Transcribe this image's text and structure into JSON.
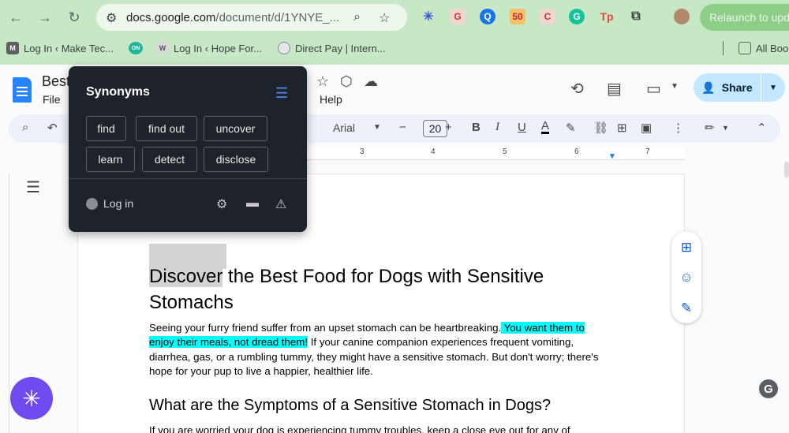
{
  "browser": {
    "url_host": "docs.google.com",
    "url_path": "/document/d/1YNYE_...",
    "relaunch_label": "Relaunch to upd",
    "bookmarks": [
      {
        "label": "Log In ‹ Make Tec...",
        "icon": "M"
      },
      {
        "label": "ON",
        "icon": ""
      },
      {
        "label": "Log In ‹ Hope For...",
        "icon": "W"
      },
      {
        "label": "Direct Pay | Intern...",
        "icon": ""
      }
    ],
    "all_bookmarks": "All Boo"
  },
  "docs": {
    "title": "Best",
    "menus": [
      "File",
      "Help"
    ],
    "share_label": "Share",
    "font": "Arial",
    "font_size": "20",
    "ruler_numbers": [
      "3",
      "4",
      "5",
      "6",
      "7"
    ]
  },
  "synonyms": {
    "title": "Synonyms",
    "chips": [
      "find",
      "find out",
      "uncover",
      "learn",
      "detect",
      "disclose"
    ],
    "login_label": "Log in"
  },
  "document": {
    "heading_highlight": "Discover",
    "heading_rest": " the Best Food for Dogs with Sensitive Stomachs",
    "para_start": "Seeing your furry friend suffer from an upset stomach can be heartbreaking.",
    "para_highlight": " You want them to enjoy their meals, not dread them!",
    "para_end": " If your canine companion experiences frequent vomiting, diarrhea, gas, or a rumbling tummy, they might have a sensitive stomach. But don't worry; there's hope for your pup to live a happier, healthier life.",
    "h2": "What are the Symptoms of a Sensitive Stomach in Dogs?",
    "para2": "If you are worried your dog is experiencing tummy troubles, keep a close eye out for any of"
  },
  "colors": {
    "chrome_bg": "#c6e8c4",
    "popup_bg": "#1e222b",
    "highlight_cyan": "#00ffff",
    "accent_blue": "#0b57d0",
    "purple_widget": "#6f4bef"
  }
}
